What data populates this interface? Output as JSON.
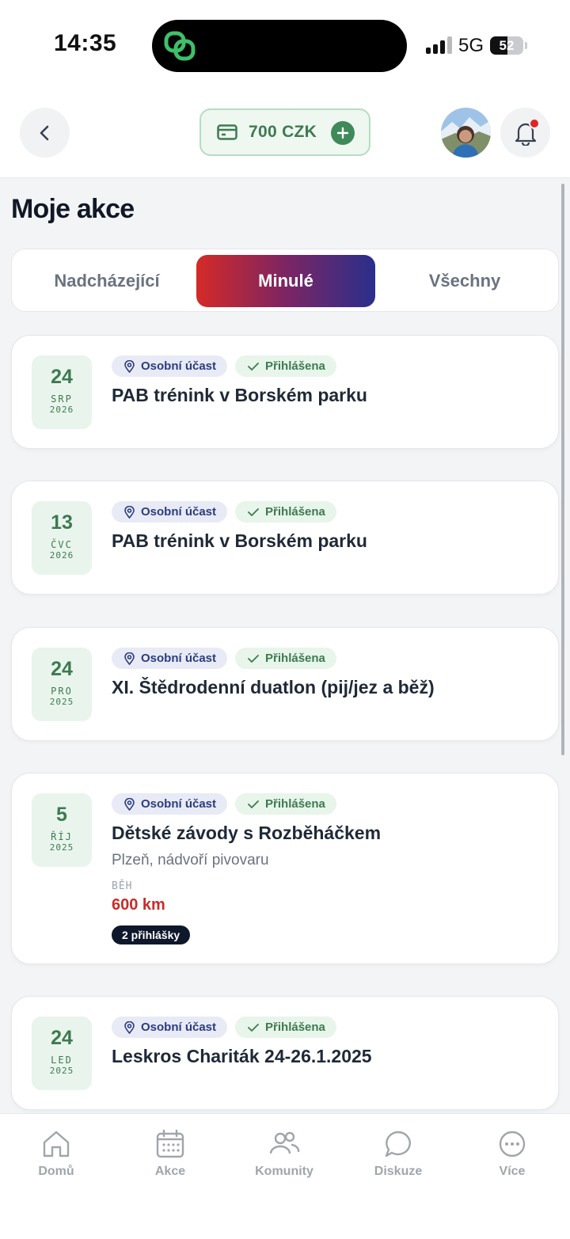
{
  "status_bar": {
    "time": "14:35",
    "network": "5G",
    "battery": "52",
    "battery_level": 0.52
  },
  "header": {
    "back_icon": "chevron-left-icon",
    "wallet_icon": "credit-card-icon",
    "wallet_amount": "700 CZK",
    "wallet_add_icon": "plus-icon",
    "notification_icon": "bell-icon",
    "accent_color": "#3d7a52"
  },
  "page": {
    "title": "Moje akce"
  },
  "tabs": [
    {
      "label": "Nadcházející",
      "active": false
    },
    {
      "label": "Minulé",
      "active": true
    },
    {
      "label": "Všechny",
      "active": false
    }
  ],
  "events": [
    {
      "day": "24",
      "month": "SRP",
      "year": "2026",
      "badge_location": "Osobní účast",
      "badge_status": "Přihlášena",
      "title": "PAB trénink v Borském parku"
    },
    {
      "day": "13",
      "month": "ČVC",
      "year": "2026",
      "badge_location": "Osobní účast",
      "badge_status": "Přihlášena",
      "title": "PAB trénink v Borském parku"
    },
    {
      "day": "24",
      "month": "PRO",
      "year": "2025",
      "badge_location": "Osobní účast",
      "badge_status": "Přihlášena",
      "title": "XI. Štědrodenní duatlon (pij/jez a běž)"
    },
    {
      "day": "5",
      "month": "ŘÍJ",
      "year": "2025",
      "badge_location": "Osobní účast",
      "badge_status": "Přihlášena",
      "title": "Dětské závody s Rozběháčkem",
      "location": "Plzeň, nádvoří pivovaru",
      "category": "BĚH",
      "distance": "600 km",
      "registrations": "2 přihlášky"
    },
    {
      "day": "24",
      "month": "LED",
      "year": "2025",
      "badge_location": "Osobní účast",
      "badge_status": "Přihlášena",
      "title": "Leskros Chariták 24-26.1.2025"
    }
  ],
  "bottom_nav": [
    {
      "label": "Domů",
      "icon": "home-icon"
    },
    {
      "label": "Akce",
      "icon": "calendar-icon"
    },
    {
      "label": "Komunity",
      "icon": "users-icon"
    },
    {
      "label": "Diskuze",
      "icon": "chat-icon"
    },
    {
      "label": "Více",
      "icon": "more-icon"
    }
  ]
}
